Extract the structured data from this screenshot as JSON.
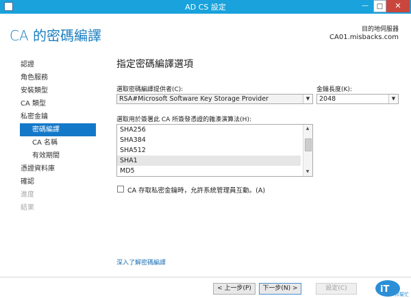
{
  "window": {
    "title": "AD CS 設定",
    "min_glyph": "—",
    "max_glyph": "□",
    "close_glyph": "✕"
  },
  "heading": "CA 的密碼編譯",
  "destination": {
    "label": "目的地伺服器",
    "server": "CA01.misbacks.com"
  },
  "nav": {
    "items": [
      {
        "label": "認證",
        "state": "normal",
        "indent": false
      },
      {
        "label": "角色服務",
        "state": "normal",
        "indent": false
      },
      {
        "label": "安裝類型",
        "state": "normal",
        "indent": false
      },
      {
        "label": "CA 類型",
        "state": "normal",
        "indent": false
      },
      {
        "label": "私密金鑰",
        "state": "normal",
        "indent": false
      },
      {
        "label": "密碼編譯",
        "state": "selected",
        "indent": true
      },
      {
        "label": "CA 名稱",
        "state": "normal",
        "indent": true
      },
      {
        "label": "有效期間",
        "state": "normal",
        "indent": true
      },
      {
        "label": "憑證資料庫",
        "state": "normal",
        "indent": false
      },
      {
        "label": "確認",
        "state": "normal",
        "indent": false
      },
      {
        "label": "進度",
        "state": "disabled",
        "indent": false
      },
      {
        "label": "結果",
        "state": "disabled",
        "indent": false
      }
    ]
  },
  "main": {
    "section_title": "指定密碼編譯選項",
    "provider": {
      "label": "選取密碼編譯提供者(C):",
      "value": "RSA#Microsoft Software Key Storage Provider"
    },
    "key_length": {
      "label": "金鑰長度(K):",
      "value": "2048"
    },
    "hash": {
      "label": "選取用於簽署此 CA 所簽發憑證的雜湊演算法(H):",
      "items": [
        "SHA256",
        "SHA384",
        "SHA512",
        "SHA1",
        "MD5"
      ],
      "selected": "SHA1"
    },
    "admin_interaction": {
      "label": "CA 存取私密金鑰時，允許系統管理員互動。(A)",
      "checked": false
    },
    "learn_more_link": "深入了解密碼編譯"
  },
  "footer": {
    "prev_label": "< 上一步(P)",
    "next_label": "下一步(N) >",
    "configure_label": "設定(C)"
  },
  "logo": {
    "mark": "iT",
    "sub": "邦幫忙"
  },
  "colors": {
    "titlebar": "#19a2db",
    "accent": "#1b7fc0",
    "selection": "#1478c8",
    "link": "#1b6fb6"
  },
  "icons": [
    "app-icon",
    "minimize-icon",
    "maximize-icon",
    "close-icon",
    "dropdown-arrow-icon",
    "scroll-up-icon",
    "scroll-down-icon"
  ]
}
